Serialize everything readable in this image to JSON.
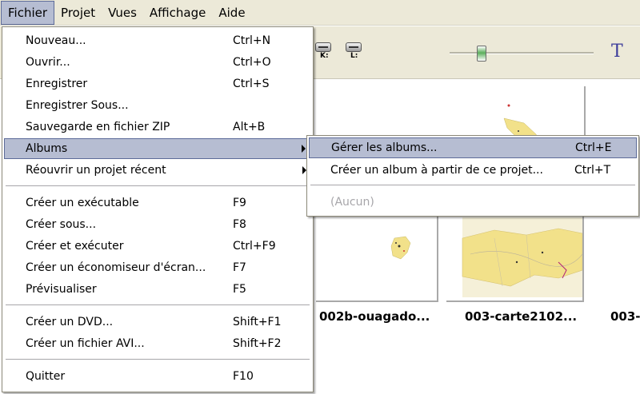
{
  "menubar": {
    "items": [
      "Fichier",
      "Projet",
      "Vues",
      "Affichage",
      "Aide"
    ]
  },
  "toolbar": {
    "drive_labels": [
      "K:",
      "L:"
    ],
    "text_tool_glyph": "T"
  },
  "file_menu": {
    "items": [
      {
        "label": "Nouveau...",
        "shortcut": "Ctrl+N"
      },
      {
        "label": "Ouvrir...",
        "shortcut": "Ctrl+O"
      },
      {
        "label": "Enregistrer",
        "shortcut": "Ctrl+S"
      },
      {
        "label": "Enregistrer Sous...",
        "shortcut": ""
      },
      {
        "label": "Sauvegarde en fichier ZIP",
        "shortcut": "Alt+B"
      },
      {
        "label": "Albums",
        "shortcut": "",
        "submenu": true,
        "highlighted": true
      },
      {
        "label": "Réouvrir un projet récent",
        "shortcut": "",
        "submenu": true
      },
      {
        "label": "Créer un exécutable",
        "shortcut": "F9"
      },
      {
        "label": "Créer sous...",
        "shortcut": "F8"
      },
      {
        "label": "Créer et exécuter",
        "shortcut": "Ctrl+F9"
      },
      {
        "label": "Créer un économiseur d'écran...",
        "shortcut": "F7"
      },
      {
        "label": "Prévisualiser",
        "shortcut": "F5"
      },
      {
        "label": "Créer un DVD...",
        "shortcut": "Shift+F1"
      },
      {
        "label": "Créer un fichier AVI...",
        "shortcut": "Shift+F2"
      },
      {
        "label": "Quitter",
        "shortcut": "F10"
      }
    ]
  },
  "albums_submenu": {
    "items": [
      {
        "label": "Gérer les albums...",
        "shortcut": "Ctrl+E",
        "highlighted": true
      },
      {
        "label": "Créer un album à partir de ce projet...",
        "shortcut": "Ctrl+T"
      },
      {
        "label": "(Aucun)",
        "shortcut": "",
        "disabled": true
      }
    ]
  },
  "thumbnails": {
    "captions": [
      "002b-ouagado...",
      "003-carte2102...",
      "003-"
    ]
  },
  "colors": {
    "menubar_bg": "#ece9d8",
    "highlight_bg": "#b6bdd2",
    "highlight_border": "#5d6b99",
    "map_yellow": "#f2e18a"
  }
}
